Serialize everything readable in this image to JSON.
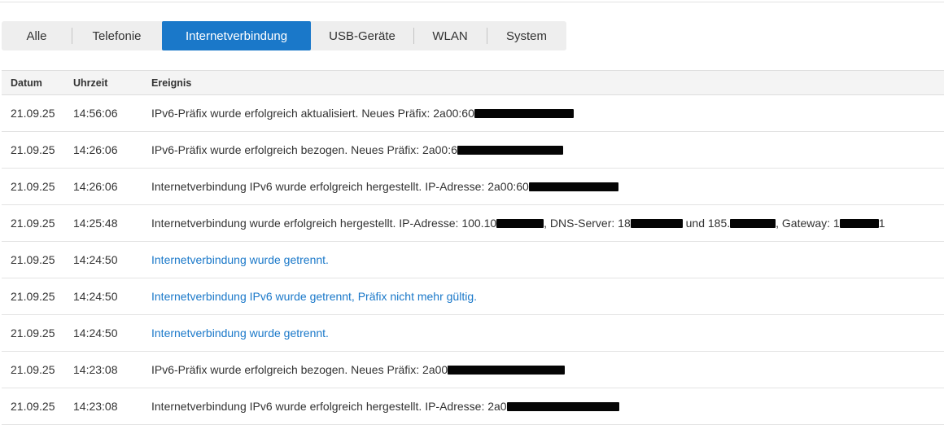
{
  "tabs": [
    {
      "label": "Alle",
      "active": false
    },
    {
      "label": "Telefonie",
      "active": false
    },
    {
      "label": "Internetverbindung",
      "active": true
    },
    {
      "label": "USB-Geräte",
      "active": false
    },
    {
      "label": "WLAN",
      "active": false
    },
    {
      "label": "System",
      "active": false
    }
  ],
  "table": {
    "headers": {
      "date": "Datum",
      "time": "Uhrzeit",
      "event": "Ereignis"
    },
    "rows": [
      {
        "date": "21.09.25",
        "time": "14:56:06",
        "event": "IPv6-Präfix wurde erfolgreich aktualisiert. Neues Präfix: 2a00:60",
        "link": false
      },
      {
        "date": "21.09.25",
        "time": "14:26:06",
        "event": "IPv6-Präfix wurde erfolgreich bezogen. Neues Präfix: 2a00:6",
        "link": false
      },
      {
        "date": "21.09.25",
        "time": "14:26:06",
        "event": "Internetverbindung IPv6 wurde erfolgreich hergestellt. IP-Adresse: 2a00:60",
        "link": false
      },
      {
        "date": "21.09.25",
        "time": "14:25:48",
        "event": "Internetverbindung wurde erfolgreich hergestellt. IP-Adresse: 100.10",
        "event_2": ", DNS-Server: 18",
        "event_3": " und 185.",
        "event_4": ", Gateway: 1",
        "event_5": "1",
        "link": false
      },
      {
        "date": "21.09.25",
        "time": "14:24:50",
        "event": "Internetverbindung wurde getrennt.",
        "link": true
      },
      {
        "date": "21.09.25",
        "time": "14:24:50",
        "event": "Internetverbindung IPv6 wurde getrennt, Präfix nicht mehr gültig.",
        "link": true
      },
      {
        "date": "21.09.25",
        "time": "14:24:50",
        "event": "Internetverbindung wurde getrennt.",
        "link": true
      },
      {
        "date": "21.09.25",
        "time": "14:23:08",
        "event": "IPv6-Präfix wurde erfolgreich bezogen. Neues Präfix: 2a00",
        "link": false
      },
      {
        "date": "21.09.25",
        "time": "14:23:08",
        "event": "Internetverbindung IPv6 wurde erfolgreich hergestellt. IP-Adresse: 2a0",
        "link": false
      }
    ]
  },
  "colors": {
    "accent": "#1a78c9",
    "tab_bg": "#eeeeee",
    "header_bg": "#f4f4f4",
    "redaction": "#050505"
  }
}
